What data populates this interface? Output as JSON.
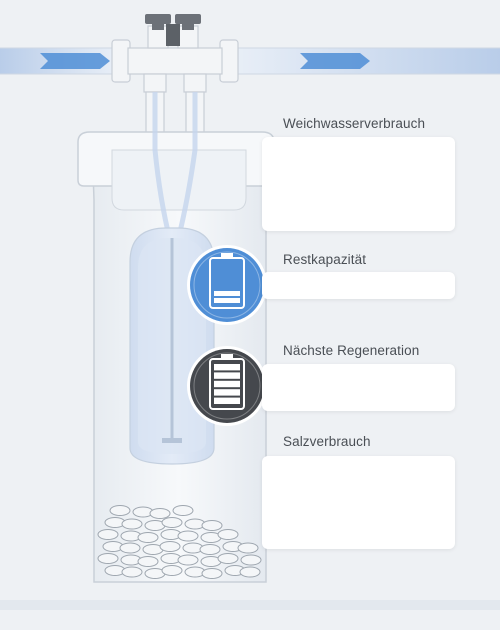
{
  "panels": [
    {
      "id": "soft-water",
      "label": "Weichwasserverbrauch"
    },
    {
      "id": "remaining-capacity",
      "label": "Restkapazität"
    },
    {
      "id": "next-regeneration",
      "label": "Nächste Regeneration"
    },
    {
      "id": "salt-consumption",
      "label": "Salzverbrauch"
    }
  ],
  "icons": {
    "capacity": {
      "name": "capacity-battery-icon",
      "color": "#4f8ed6",
      "filled_segments": 2,
      "total_segments": 6
    },
    "regeneration": {
      "name": "regeneration-battery-icon",
      "color": "#45484d",
      "filled_segments": 5,
      "total_segments": 5
    }
  },
  "colors": {
    "background": "#eef1f4",
    "water_arrow": "#4f8ed6",
    "resin_tank": "#dbe6f4",
    "tank_body": "#f4f6f8"
  }
}
